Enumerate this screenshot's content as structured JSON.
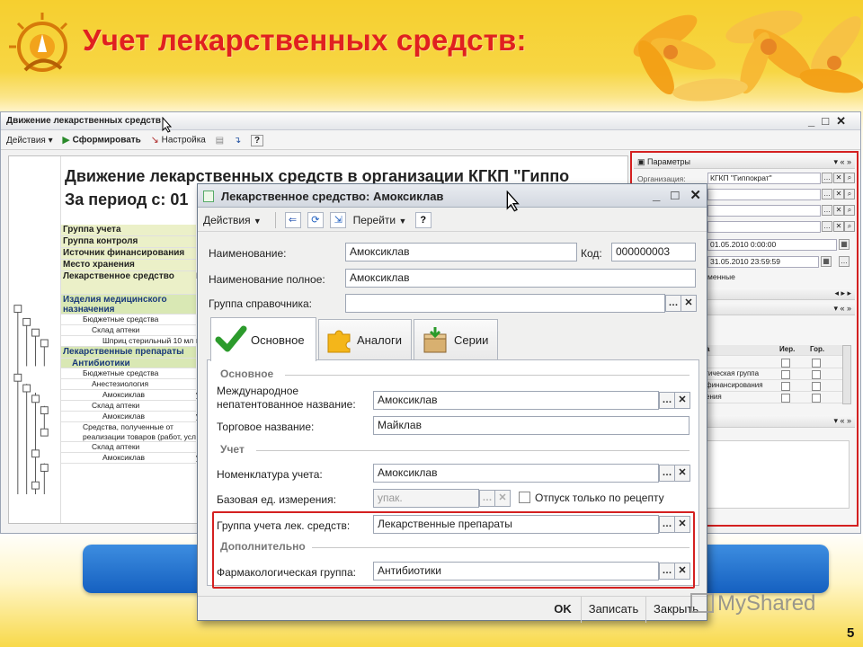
{
  "slide": {
    "title": "Учет лекарственных средств:",
    "number": "5",
    "watermark": "MyShared",
    "accent_color": "#e02020",
    "bar_color": "#1f6fd0"
  },
  "bg_window": {
    "title": "Движение лекарственных средств",
    "toolbar": {
      "actions": "Действия ▾",
      "generate": "Сформировать",
      "settings": "Настройка",
      "help": "?"
    },
    "report": {
      "title": "Движение лекарственных средств в организации КГКП \"Гиппо",
      "period": "За период с: 01",
      "rows": [
        {
          "text": "Группа учета",
          "kind": "head"
        },
        {
          "text": "Группа контроля",
          "kind": "head"
        },
        {
          "text": "Источник финансирования",
          "kind": "head"
        },
        {
          "text": "Место хранения",
          "kind": "head"
        },
        {
          "text": "Лекарственное средство",
          "kind": "head2",
          "cell": "Е"
        },
        {
          "text": "Изделия медицинского назначения",
          "kind": "group"
        },
        {
          "text": "Бюджетные средства",
          "kind": "sub"
        },
        {
          "text": "Склад аптеки",
          "kind": "sub2"
        },
        {
          "text": "Шприц стерильный 10 мл",
          "kind": "sub3",
          "cell": "ш"
        },
        {
          "text": "Лекарственные препараты",
          "kind": "group"
        },
        {
          "text": "Антибиотики",
          "kind": "group2"
        },
        {
          "text": "Бюджетные средства",
          "kind": "sub"
        },
        {
          "text": "Анестезиология",
          "kind": "sub2"
        },
        {
          "text": "Амоксиклав",
          "kind": "sub3",
          "cell": "уп"
        },
        {
          "text": "Склад аптеки",
          "kind": "sub2"
        },
        {
          "text": "Амоксиклав",
          "kind": "sub3",
          "cell": "уп"
        },
        {
          "text": "Средства, полученные от реализации товаров (работ, усл",
          "kind": "sub"
        },
        {
          "text": "Склад аптеки",
          "kind": "sub2"
        },
        {
          "text": "Амоксиклав",
          "kind": "sub3",
          "cell": "уп"
        }
      ]
    },
    "params": {
      "header": "Параметры",
      "org_label": "Организация:",
      "org_value": "КГКП \"Гиппократ\"",
      "date_from": "01.05.2010 0:00:00",
      "date_to": "31.05.2010 23:59:59",
      "partial_text": "менные",
      "grid_cols": [
        "а",
        "Иер.",
        "Гор."
      ],
      "grid_rows": [
        "",
        "гическая группа",
        "финансирования",
        "ения"
      ]
    }
  },
  "dialog": {
    "title": "Лекарственное средство: Амоксиклав",
    "toolbar": {
      "actions": "Действия",
      "goto": "Перейти",
      "help": "?"
    },
    "fields": {
      "name_label": "Наименование:",
      "name_value": "Амоксиклав",
      "code_label": "Код:",
      "code_value": "000000003",
      "fullname_label": "Наименование полное:",
      "fullname_value": "Амоксиклав",
      "group_label": "Группа справочника:",
      "group_value": ""
    },
    "tabs": [
      {
        "label": "Основное",
        "icon": "checkmark-icon"
      },
      {
        "label": "Аналоги",
        "icon": "puzzle-icon"
      },
      {
        "label": "Серии",
        "icon": "box-icon"
      }
    ],
    "main_tab": {
      "section_basic": "Основное",
      "inn_label": "Международное непатентованное название:",
      "inn_value": "Амоксиклав",
      "trade_label": "Торговое название:",
      "trade_value": "Майклав",
      "section_account": "Учет",
      "nomen_label": "Номенклатура учета:",
      "nomen_value": "Амоксиклав",
      "unit_label": "Базовая ед. измерения:",
      "unit_value": "упак.",
      "rx_label": "Отпуск только по рецепту",
      "rx_checked": false,
      "acc_group_label": "Группа учета лек. средств:",
      "acc_group_value": "Лекарственные препараты",
      "section_extra": "Дополнительно",
      "pharm_label": "Фармакологическая группа:",
      "pharm_value": "Антибиотики"
    },
    "footer": {
      "ok": "OK",
      "save": "Записать",
      "close": "Закрыть"
    }
  }
}
